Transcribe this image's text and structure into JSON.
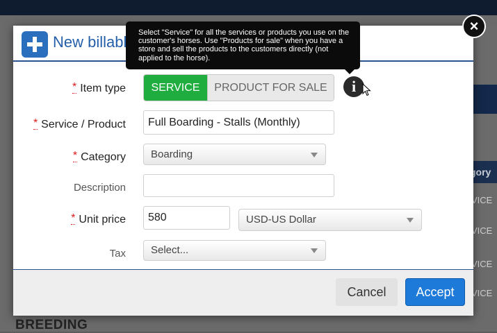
{
  "background": {
    "column_header": "gory",
    "cells": [
      "VICE",
      "VICE",
      "VICE",
      "VICE",
      "VICE"
    ],
    "section_title": "BREEDING"
  },
  "modal": {
    "title": "New billable",
    "close_label": "×",
    "tooltip": "Select \"Service\" for all the services or products you use on the customer's horses. Use \"Products for sale\" when you have a store and sell the products to the customers directly (not applied to the horse).",
    "required_marker": "*",
    "item_type": {
      "label": "Item type",
      "options": [
        "SERVICE",
        "PRODUCT FOR SALE"
      ],
      "selected": "SERVICE"
    },
    "service_product": {
      "label": "Service / Product",
      "value": "Full Boarding - Stalls (Monthly)"
    },
    "category": {
      "label": "Category",
      "value": "Boarding"
    },
    "description": {
      "label": "Description",
      "value": ""
    },
    "unit_price": {
      "label": "Unit price",
      "value": "580",
      "currency": "USD-US Dollar"
    },
    "tax": {
      "label": "Tax",
      "value": "Select..."
    },
    "buttons": {
      "cancel": "Cancel",
      "accept": "Accept"
    },
    "colors": {
      "accent": "#245faa",
      "toggle_on": "#1fad3f",
      "accept": "#1e7ad8",
      "required": "#d81c1c"
    }
  }
}
